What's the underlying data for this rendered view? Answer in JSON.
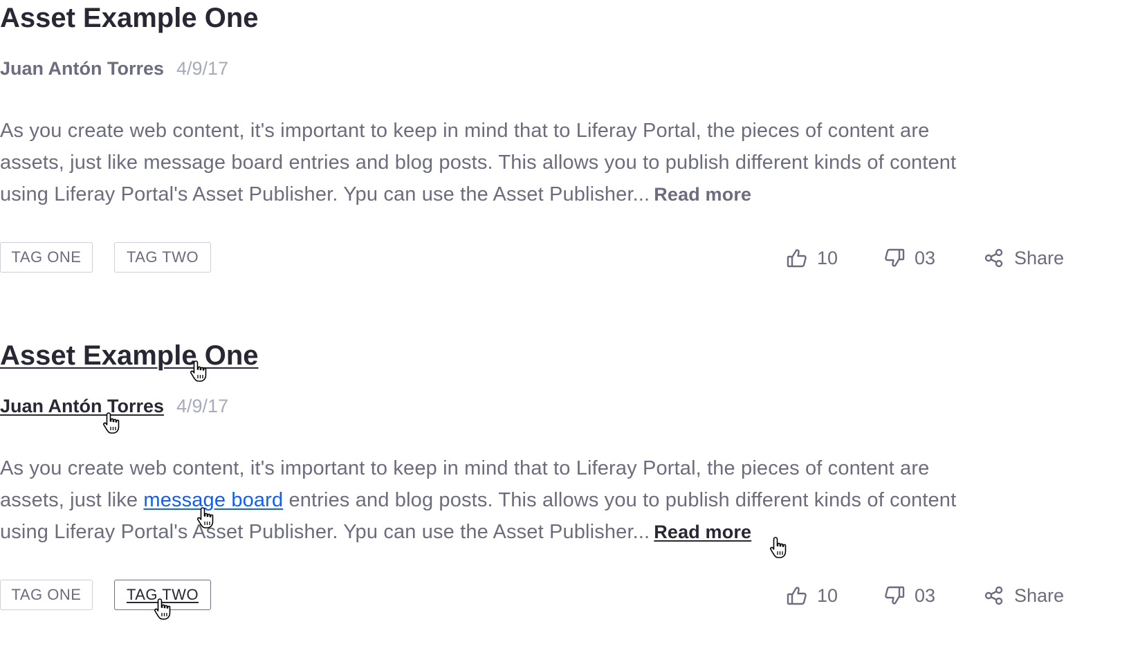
{
  "cards": [
    {
      "title": "Asset Example One",
      "author": "Juan Antón Torres",
      "date": "4/9/17",
      "excerpt": {
        "line1": "As you create web content, it's important to keep in mind that to Liferay Portal, the pieces of content are",
        "line2_before": "assets, just like message board entries and blog posts. This allows you to publish different kinds of content",
        "line3": "using Liferay Portal's Asset Publisher. Ypu can use the Asset Publisher..."
      },
      "read_more": "Read more",
      "tags": [
        "TAG ONE",
        "TAG TWO"
      ],
      "likes": "10",
      "dislikes": "03",
      "share_label": "Share"
    },
    {
      "title": "Asset Example One",
      "author": "Juan Antón Torres",
      "date": "4/9/17",
      "excerpt": {
        "line1": "As you create web content, it's important to keep in mind that to Liferay Portal, the pieces of content are",
        "line2_before": "assets, just like ",
        "line2_link": "message board",
        "line2_after": " entries and blog posts. This allows you to publish different kinds of content",
        "line3": "using Liferay Portal's Asset Publisher. Ypu can use the Asset Publisher..."
      },
      "read_more": "Read more",
      "tags": [
        "TAG ONE",
        "TAG TWO"
      ],
      "likes": "10",
      "dislikes": "03",
      "share_label": "Share"
    }
  ],
  "colors": {
    "title": "#272833",
    "body_text": "#6b6c7e",
    "date": "#a7a9bc",
    "link": "#0b5fff",
    "tag_border": "#cdced9"
  },
  "icons": {
    "like": "thumbs-up-icon",
    "dislike": "thumbs-down-icon",
    "share": "share-icon",
    "cursor": "hand-pointer-cursor"
  }
}
